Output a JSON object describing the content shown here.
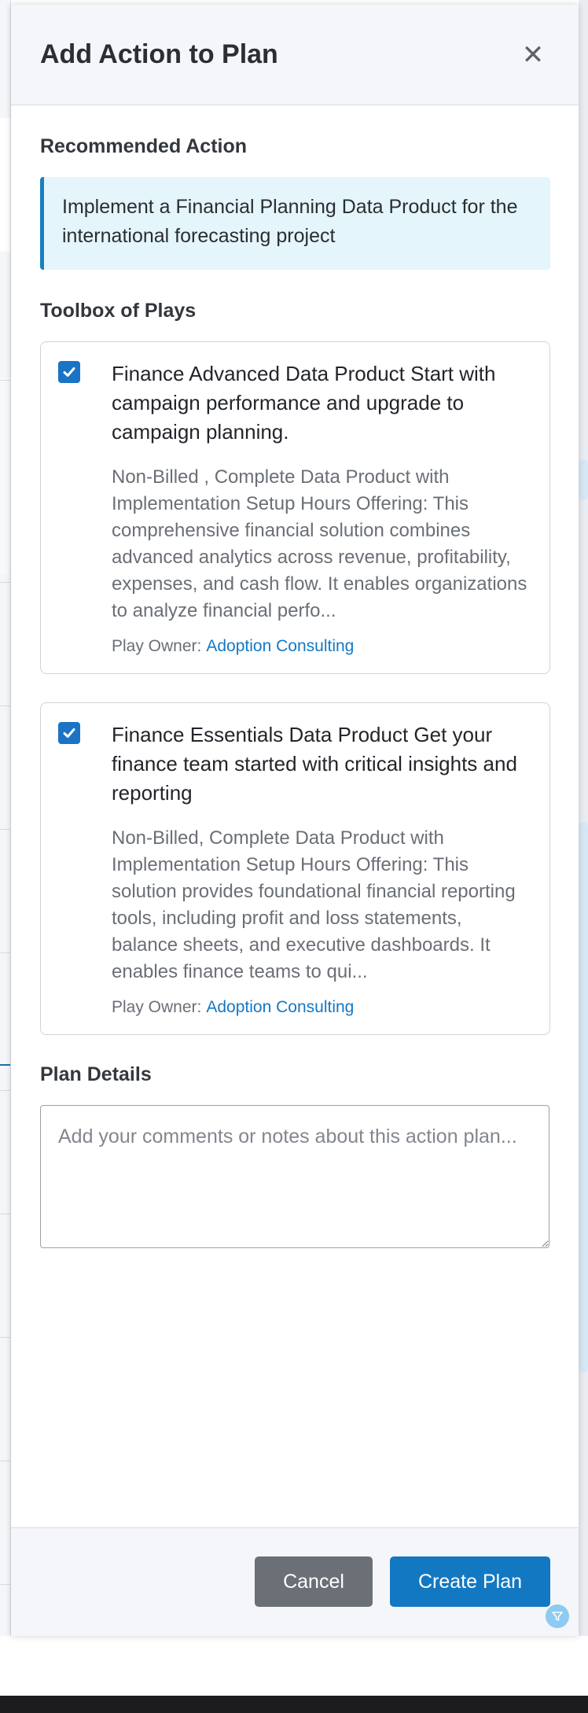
{
  "modal": {
    "title": "Add Action to Plan",
    "close_icon": "close-icon"
  },
  "recommended": {
    "label": "Recommended Action",
    "text": "Implement a Financial Planning Data Product for the international forecasting project"
  },
  "toolbox": {
    "label": "Toolbox of Plays",
    "plays": [
      {
        "checked": true,
        "title": "Finance Advanced Data Product Start with campaign performance and upgrade to campaign planning.",
        "description": "Non-Billed , Complete Data Product with Implementation Setup Hours Offering: This comprehensive financial solution combines advanced analytics across revenue, profitability, expenses, and cash flow. It enables organizations to analyze financial perfo...",
        "owner_label": "Play Owner:",
        "owner": "Adoption Consulting"
      },
      {
        "checked": true,
        "title": "Finance Essentials Data Product Get your finance team started with critical insights and reporting",
        "description": "Non-Billed, Complete Data Product with Implementation Setup Hours Offering: This solution provides foundational financial reporting tools, including profit and loss statements, balance sheets, and executive dashboards. It enables finance teams to qui...",
        "owner_label": "Play Owner:",
        "owner": "Adoption Consulting"
      }
    ]
  },
  "plan_details": {
    "label": "Plan Details",
    "placeholder": "Add your comments or notes about this action plan..."
  },
  "footer": {
    "cancel_label": "Cancel",
    "create_label": "Create Plan"
  },
  "colors": {
    "primary": "#1378c2",
    "secondary_button": "#6b7077",
    "recommend_bg": "#e5f5fc",
    "checkbox": "#1a73c5"
  }
}
